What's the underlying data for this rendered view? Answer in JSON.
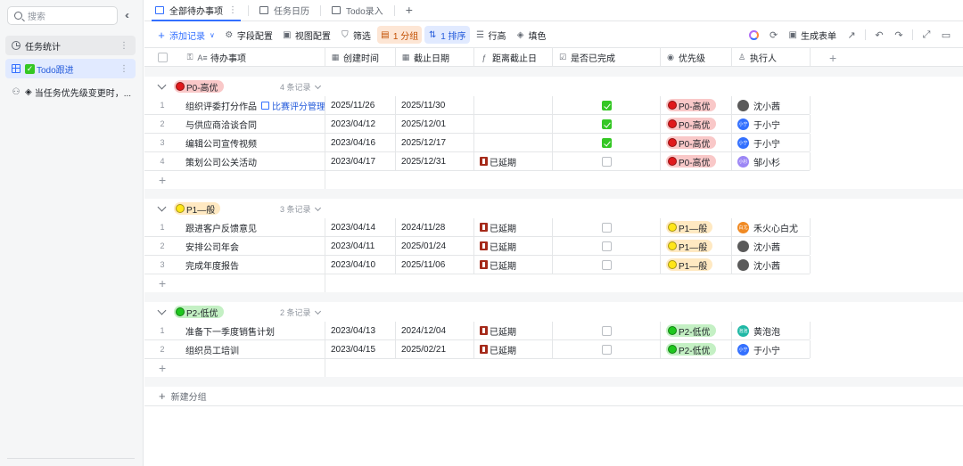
{
  "sidebar": {
    "search_placeholder": "搜索",
    "collapse_icon": "double-chevron-left-icon",
    "items": [
      {
        "label": "任务统计",
        "icon": "clock-icon"
      },
      {
        "label": "Todo跟进",
        "icon": "grid-icon",
        "emoji": "✅"
      },
      {
        "label": "当任务优先级变更时，...",
        "icon": "automation-icon",
        "emoji": "📎"
      }
    ]
  },
  "tabs": [
    {
      "label": "全部待办事项",
      "active": true
    },
    {
      "label": "任务日历",
      "active": false
    },
    {
      "label": "Todo录入",
      "active": false
    }
  ],
  "toolbar": {
    "add_record": "添加记录",
    "field_config": "字段配置",
    "view_config": "视图配置",
    "filter": "筛选",
    "group": "1 分组",
    "sort": "1 排序",
    "row_height": "行高",
    "fill_color": "填色",
    "generate_form": "生成表单"
  },
  "columns": [
    "待办事项",
    "创建时间",
    "截止日期",
    "距离截止日",
    "是否已完成",
    "优先级",
    "执行人"
  ],
  "groups": [
    {
      "tag": "P0-高优",
      "level": "p0",
      "count": "4 条记录",
      "rows": [
        {
          "idx": "1",
          "task": "组织评委打分作品",
          "link": "比赛评分管理",
          "created": "2025/11/26",
          "due": "2025/11/30",
          "status": "",
          "done": true,
          "priority": "P0-高优",
          "owner": "沈小茜",
          "avatar_color": "#5a5a5a",
          "avatar_text": ""
        },
        {
          "idx": "2",
          "task": "与供应商洽谈合同",
          "link": "",
          "created": "2023/04/12",
          "due": "2025/12/01",
          "status": "",
          "done": true,
          "priority": "P0-高优",
          "owner": "于小宁",
          "avatar_color": "#3370ff",
          "avatar_text": "小宁"
        },
        {
          "idx": "3",
          "task": "编辑公司宣传视频",
          "link": "",
          "created": "2023/04/16",
          "due": "2025/12/17",
          "status": "",
          "done": true,
          "priority": "P0-高优",
          "owner": "于小宁",
          "avatar_color": "#3370ff",
          "avatar_text": "小宁"
        },
        {
          "idx": "4",
          "task": "策划公司公关活动",
          "link": "",
          "created": "2023/04/17",
          "due": "2025/12/31",
          "status": "已延期",
          "done": false,
          "priority": "P0-高优",
          "owner": "邹小杉",
          "avatar_color": "#9c86f5",
          "avatar_text": "小杉"
        }
      ]
    },
    {
      "tag": "P1—般",
      "level": "p1",
      "count": "3 条记录",
      "rows": [
        {
          "idx": "1",
          "task": "跟进客户反馈意见",
          "link": "",
          "created": "2023/04/14",
          "due": "2024/11/28",
          "status": "已延期",
          "done": false,
          "priority": "P1—般",
          "owner": "禾火心白尤",
          "avatar_color": "#f08a24",
          "avatar_text": "白尤"
        },
        {
          "idx": "2",
          "task": "安排公司年会",
          "link": "",
          "created": "2023/04/11",
          "due": "2025/01/24",
          "status": "已延期",
          "done": false,
          "priority": "P1—般",
          "owner": "沈小茜",
          "avatar_color": "#5a5a5a",
          "avatar_text": ""
        },
        {
          "idx": "3",
          "task": "完成年度报告",
          "link": "",
          "created": "2023/04/10",
          "due": "2025/11/06",
          "status": "已延期",
          "done": false,
          "priority": "P1—般",
          "owner": "沈小茜",
          "avatar_color": "#5a5a5a",
          "avatar_text": ""
        }
      ]
    },
    {
      "tag": "P2-低优",
      "level": "p2",
      "count": "2 条记录",
      "rows": [
        {
          "idx": "1",
          "task": "准备下一季度销售计划",
          "link": "",
          "created": "2023/04/13",
          "due": "2024/12/04",
          "status": "已延期",
          "done": false,
          "priority": "P2-低优",
          "owner": "黄泡泡",
          "avatar_color": "#1fb8a5",
          "avatar_text": "泡泡"
        },
        {
          "idx": "2",
          "task": "组织员工培训",
          "link": "",
          "created": "2023/04/15",
          "due": "2025/02/21",
          "status": "已延期",
          "done": false,
          "priority": "P2-低优",
          "owner": "于小宁",
          "avatar_color": "#3370ff",
          "avatar_text": "小宁"
        }
      ]
    }
  ],
  "new_group": "新建分组",
  "colors": {
    "accent": "#3370ff",
    "done_green": "#34c724",
    "p0": "#e0191c",
    "p1": "#ffe619",
    "p2": "#1ec71e"
  }
}
